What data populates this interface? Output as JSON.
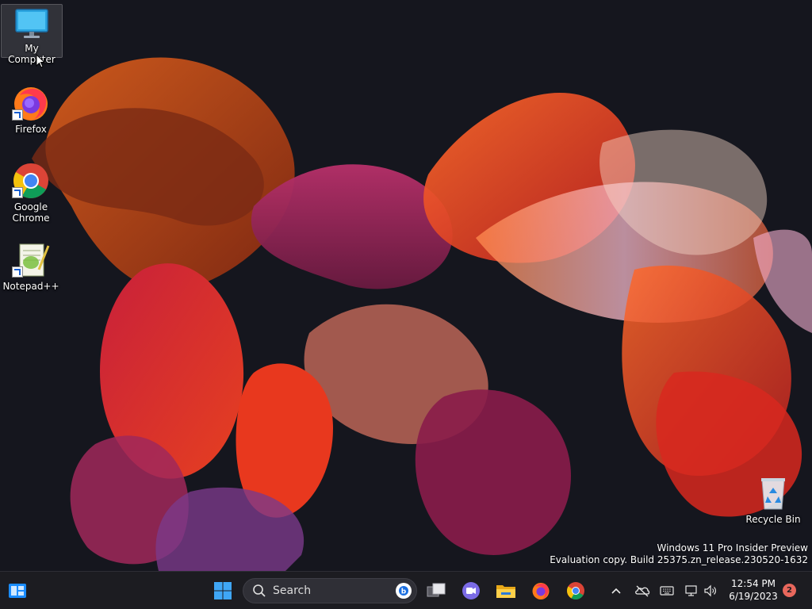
{
  "desktop": {
    "icons": [
      {
        "label": "My Computer",
        "icon": "monitor-icon"
      },
      {
        "label": "Firefox",
        "icon": "firefox-icon"
      },
      {
        "label": "Google Chrome",
        "icon": "chrome-icon"
      },
      {
        "label": "Notepad++",
        "icon": "notepadpp-icon"
      },
      {
        "label": "Recycle Bin",
        "icon": "recycle-bin-icon"
      }
    ],
    "watermark": {
      "line1": "Windows 11 Pro Insider Preview",
      "line2": "Evaluation copy. Build 25375.zn_release.230520-1632"
    }
  },
  "taskbar": {
    "search_placeholder": "Search",
    "pinned": [
      "widgets-icon",
      "start-icon",
      "task-view-icon",
      "teams-chat-icon",
      "file-explorer-icon",
      "firefox-icon",
      "chrome-icon"
    ],
    "tray": [
      "chevron-up-icon",
      "onedrive-icon",
      "keyboard-icon",
      "network-icon",
      "volume-icon"
    ],
    "clock": {
      "time": "12:54 PM",
      "date": "6/19/2023"
    },
    "notification_count": "2"
  },
  "colors": {
    "taskbar_bg": "#1c1c21",
    "accent": "#1a8cff",
    "badge": "#e8675c"
  }
}
